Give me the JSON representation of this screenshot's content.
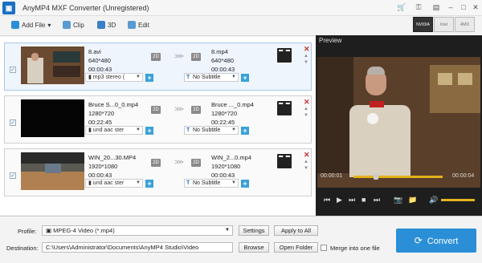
{
  "window": {
    "title": "AnyMP4 MXF Converter (Unregistered)",
    "app_icon": "film-icon"
  },
  "toolbar": {
    "add_file": "Add File",
    "clip": "Clip",
    "threed": "3D",
    "edit": "Edit"
  },
  "hw_accel": [
    {
      "label": "NVIDIA"
    },
    {
      "label": "Intel"
    },
    {
      "label": "AMD"
    }
  ],
  "items": [
    {
      "src_name": "8.avi",
      "src_res": "640*480",
      "src_dur": "00:00:43",
      "badge": "2D",
      "dst_name": "8.mp4",
      "dst_res": "640*480",
      "dst_dur": "00:00:43",
      "audio": "mp3 stereo (",
      "subtitle": "No Subtitle"
    },
    {
      "src_name": "Bruce S...0_0.mp4",
      "src_res": "1280*720",
      "src_dur": "00:22:45",
      "badge": "2D",
      "dst_name": "Bruce ..._0.mp4",
      "dst_res": "1280*720",
      "dst_dur": "00:22:45",
      "audio": "und aac ster",
      "subtitle": "No Subtitle"
    },
    {
      "src_name": "WIN_20...30.MP4",
      "src_res": "1920*1080",
      "src_dur": "00:00:43",
      "badge": "2D",
      "dst_name": "WIN_2...0.mp4",
      "dst_res": "1920*1080",
      "dst_dur": "00:00:43",
      "audio": "und aac ster",
      "subtitle": "No Subtitle"
    }
  ],
  "preview": {
    "label": "Preview",
    "time_current": "00:00:01",
    "time_total": "00:00:04",
    "progress": 0.25,
    "volume": 1.0
  },
  "bottom": {
    "profile_label": "Profile:",
    "profile_value": "MPEG-4 Video (*.mp4)",
    "settings": "Settings",
    "apply_all": "Apply to All",
    "dest_label": "Destination:",
    "dest_value": "C:\\Users\\Administrator\\Documents\\AnyMP4 Studio\\Video",
    "browse": "Browse",
    "open_folder": "Open Folder",
    "merge": "Merge into one file",
    "convert": "Convert"
  },
  "colors": {
    "accent": "#2b8fd8",
    "progress": "#e3b21e",
    "close": "#cc3333"
  }
}
